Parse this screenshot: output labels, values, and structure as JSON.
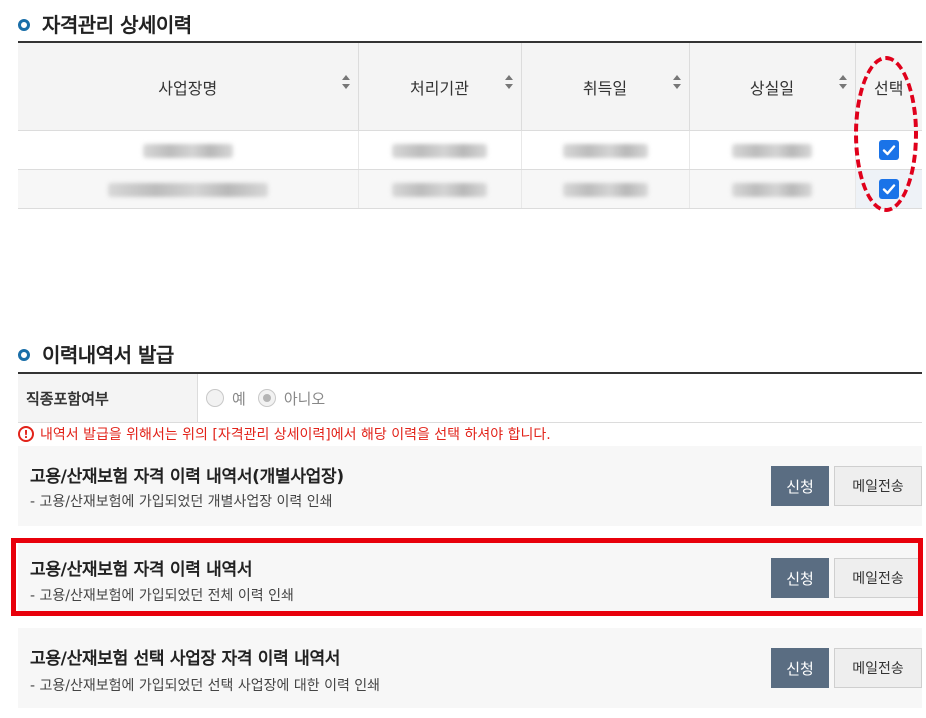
{
  "section1": {
    "title": "자격관리 상세이력"
  },
  "table": {
    "headers": [
      "사업장명",
      "처리기관",
      "취득일",
      "상실일",
      "선택"
    ],
    "rows": [
      {
        "selected": true
      },
      {
        "selected": true
      }
    ]
  },
  "section2": {
    "title": "이력내역서 발급"
  },
  "option": {
    "label": "직종포함여부",
    "choices": [
      "예",
      "아니오"
    ],
    "selected": "아니오"
  },
  "warning": {
    "icon": "!",
    "text": "내역서 발급을 위해서는 위의 [자격관리 상세이력]에서 해당 이력을 선택 하셔야 합니다."
  },
  "cards": [
    {
      "title": "고용/산재보험 자격 이력 내역서(개별사업장)",
      "desc": "- 고용/산재보험에 가입되었던 개별사업장 이력 인쇄",
      "apply": "신청",
      "mail": "메일전송"
    },
    {
      "title": "고용/산재보험 자격 이력 내역서",
      "desc": "- 고용/산재보험에 가입되었던 전체 이력 인쇄",
      "apply": "신청",
      "mail": "메일전송"
    },
    {
      "title": "고용/산재보험 선택 사업장 자격 이력 내역서",
      "desc": "- 고용/산재보험에 가입되었던 선택 사업장에 대한 이력 인쇄",
      "apply": "신청",
      "mail": "메일전송"
    }
  ],
  "colors": {
    "accent": "#1a6ea8",
    "warning": "#e2231a",
    "highlight": "#e8000b",
    "apply_button": "#5a6d82",
    "checkbox": "#1a73e8"
  }
}
